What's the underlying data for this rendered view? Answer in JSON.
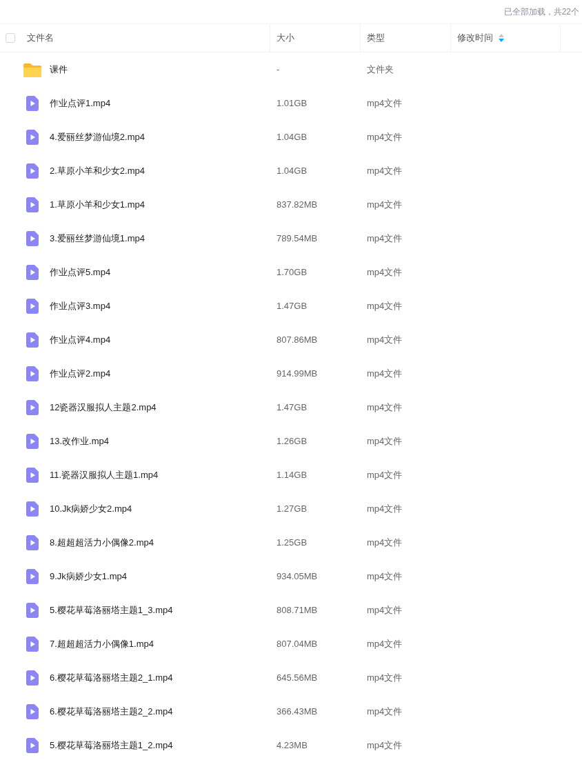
{
  "status_text": "已全部加载，共22个",
  "table": {
    "select_all": {
      "checked": false
    },
    "columns": [
      {
        "label": "文件名"
      },
      {
        "label": "大小"
      },
      {
        "label": "类型"
      },
      {
        "label": "修改时间",
        "sort_descending": true
      }
    ],
    "rows": [
      {
        "kind": "folder",
        "name": "课件",
        "size": "-",
        "type": "文件夹"
      },
      {
        "kind": "video",
        "name": "作业点评1.mp4",
        "size": "1.01GB",
        "type": "mp4文件"
      },
      {
        "kind": "video",
        "name": "4.爱丽丝梦游仙境2.mp4",
        "size": "1.04GB",
        "type": "mp4文件"
      },
      {
        "kind": "video",
        "name": "2.草原小羊和少女2.mp4",
        "size": "1.04GB",
        "type": "mp4文件"
      },
      {
        "kind": "video",
        "name": "1.草原小羊和少女1.mp4",
        "size": "837.82MB",
        "type": "mp4文件"
      },
      {
        "kind": "video",
        "name": "3.爱丽丝梦游仙境1.mp4",
        "size": "789.54MB",
        "type": "mp4文件"
      },
      {
        "kind": "video",
        "name": "作业点评5.mp4",
        "size": "1.70GB",
        "type": "mp4文件"
      },
      {
        "kind": "video",
        "name": "作业点评3.mp4",
        "size": "1.47GB",
        "type": "mp4文件"
      },
      {
        "kind": "video",
        "name": "作业点评4.mp4",
        "size": "807.86MB",
        "type": "mp4文件"
      },
      {
        "kind": "video",
        "name": "作业点评2.mp4",
        "size": "914.99MB",
        "type": "mp4文件"
      },
      {
        "kind": "video",
        "name": "12瓷器汉服拟人主题2.mp4",
        "size": "1.47GB",
        "type": "mp4文件"
      },
      {
        "kind": "video",
        "name": "13.改作业.mp4",
        "size": "1.26GB",
        "type": "mp4文件"
      },
      {
        "kind": "video",
        "name": "11.瓷器汉服拟人主题1.mp4",
        "size": "1.14GB",
        "type": "mp4文件"
      },
      {
        "kind": "video",
        "name": "10.Jk病娇少女2.mp4",
        "size": "1.27GB",
        "type": "mp4文件"
      },
      {
        "kind": "video",
        "name": "8.超超超活力小偶像2.mp4",
        "size": "1.25GB",
        "type": "mp4文件"
      },
      {
        "kind": "video",
        "name": "9.Jk病娇少女1.mp4",
        "size": "934.05MB",
        "type": "mp4文件"
      },
      {
        "kind": "video",
        "name": "5.樱花草莓洛丽塔主题1_3.mp4",
        "size": "808.71MB",
        "type": "mp4文件"
      },
      {
        "kind": "video",
        "name": "7.超超超活力小偶像1.mp4",
        "size": "807.04MB",
        "type": "mp4文件"
      },
      {
        "kind": "video",
        "name": "6.樱花草莓洛丽塔主题2_1.mp4",
        "size": "645.56MB",
        "type": "mp4文件"
      },
      {
        "kind": "video",
        "name": "6.樱花草莓洛丽塔主题2_2.mp4",
        "size": "366.43MB",
        "type": "mp4文件"
      },
      {
        "kind": "video",
        "name": "5.樱花草莓洛丽塔主题1_2.mp4",
        "size": "4.23MB",
        "type": "mp4文件"
      }
    ]
  }
}
